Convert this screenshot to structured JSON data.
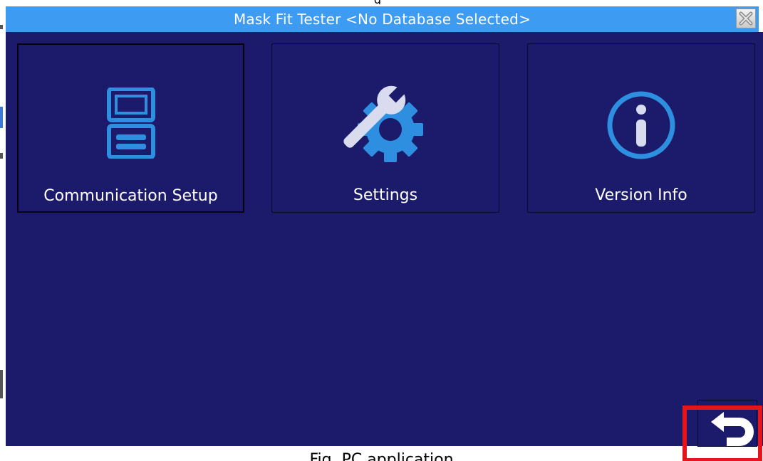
{
  "window": {
    "title": "Mask Fit Tester <No Database Selected>",
    "close_icon": "close-icon",
    "title_bar_color": "#3d9bf2",
    "background_color": "#1b1a6b"
  },
  "top_caption": "g",
  "tiles": [
    {
      "label": "Communication Setup",
      "icon": "communication-icon",
      "selected": true
    },
    {
      "label": "Settings",
      "icon": "settings-wrench-gear-icon",
      "selected": false
    },
    {
      "label": "Version Info",
      "icon": "info-icon",
      "selected": false
    }
  ],
  "back_button": {
    "icon": "back-arrow-icon",
    "highlighted": true,
    "highlight_color": "#e8141c"
  },
  "figure_caption": "Fig. PC application"
}
